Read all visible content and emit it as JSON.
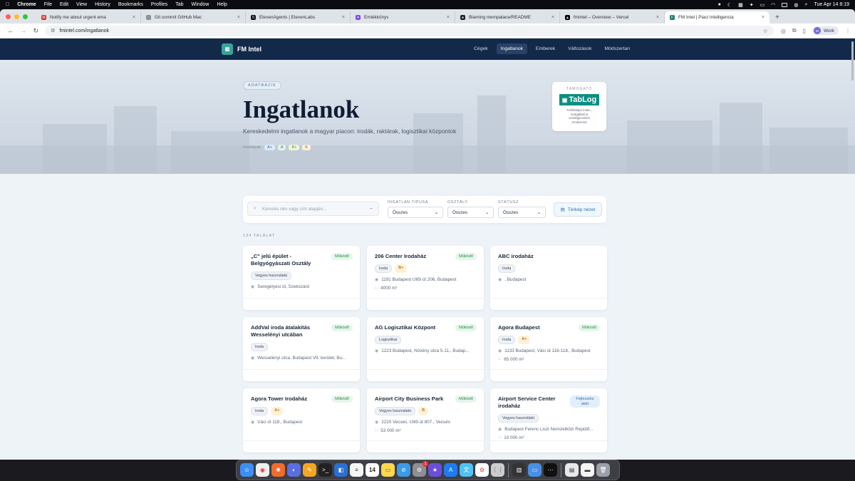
{
  "menubar": {
    "apple": "",
    "items": [
      "Chrome",
      "File",
      "Edit",
      "View",
      "History",
      "Bookmarks",
      "Profiles",
      "Tab",
      "Window",
      "Help"
    ],
    "datetime": "Tue Apr 14  8:19"
  },
  "tabs": [
    {
      "title": "Notify me about urgent ema",
      "color": "#d93025",
      "glyph": "M"
    },
    {
      "title": "Git commit GitHub Mac",
      "color": "#8a8f98",
      "glyph": "◌"
    },
    {
      "title": "ElevenAgents | ElevenLabs",
      "color": "#111111",
      "glyph": "II"
    },
    {
      "title": "Emlékkönyv",
      "color": "#7c4dff",
      "glyph": "✦"
    },
    {
      "title": "Blaming mempalace/README",
      "color": "#1f2328",
      "glyph": "●"
    },
    {
      "title": "fmintel – Overview – Vercel",
      "color": "#000000",
      "glyph": "▲"
    },
    {
      "title": "FM Intel | Piaci Intelligencia",
      "color": "#1f7a70",
      "glyph": "F"
    }
  ],
  "address": {
    "url": "fmintel.com/ingatlanok"
  },
  "profile": {
    "initials": "W",
    "label": "Work"
  },
  "site": {
    "logo_text": "FM Intel",
    "nav": [
      {
        "label": "Cégek",
        "active": false
      },
      {
        "label": "Ingatlanok",
        "active": true
      },
      {
        "label": "Emberek",
        "active": false
      },
      {
        "label": "Változások",
        "active": false
      },
      {
        "label": "Módszertan",
        "active": false
      }
    ]
  },
  "hero": {
    "badge": "ADATBÁZIS",
    "title": "Ingatlanok",
    "subtitle": "Kereskedelmi ingatlanok a magyar piacon: irodák, raktárak, logisztikai központok",
    "grades_label": "Osztályok:",
    "grades": [
      {
        "label": "A+",
        "bg": "#dde9f8",
        "fg": "#3b6fb0"
      },
      {
        "label": "A",
        "bg": "#e2f3ea",
        "fg": "#2f8a4b"
      },
      {
        "label": "B+",
        "bg": "#eef4dd",
        "fg": "#6b8a2a"
      },
      {
        "label": "B",
        "bg": "#fbeedd",
        "fg": "#b57a0e"
      }
    ]
  },
  "sponsor": {
    "label": "TÁMOGATÓ",
    "brand": "TabLog",
    "description": "Felhőalapú iroda-, szolgáltató & vendégkezelési rendszerek"
  },
  "filters": {
    "search_placeholder": "Keresés név vagy cím alapján...",
    "type_label": "INGATLAN TÍPUSA",
    "type_value": "Összes",
    "class_label": "OSZTÁLY",
    "class_value": "Összes",
    "status_label": "STÁTUSZ",
    "status_value": "Összes",
    "map_button": "Térkép nézet"
  },
  "result_count": "134 TALÁLAT",
  "cards": [
    {
      "title": "„C\" jelű épület - Belgyógyászati Osztály",
      "status": "Működő",
      "status_kind": "ok",
      "tags": [
        "Vegyes használatú"
      ],
      "grade": "",
      "address": "Seregélyesi út, Szekszárd",
      "area": ""
    },
    {
      "title": "206 Center Irodaház",
      "status": "Működő",
      "status_kind": "ok",
      "tags": [
        "Iroda"
      ],
      "grade": "B+",
      "address": "1191 Budapest Üllői út 206, Budapest",
      "area": "4000 m²"
    },
    {
      "title": "ABC irodaház",
      "status": "",
      "status_kind": "",
      "tags": [
        "Iroda"
      ],
      "grade": "",
      "address": ", Budapest",
      "area": ""
    },
    {
      "title": "AddVal iroda átalakítás Wesselényi utcában",
      "status": "Működő",
      "status_kind": "ok",
      "tags": [
        "Iroda"
      ],
      "grade": "",
      "address": "Wesselényi utca, Budapest VII. kerület, Bu...",
      "area": ""
    },
    {
      "title": "AG Logisztikai Központ",
      "status": "Működő",
      "status_kind": "ok",
      "tags": [
        "Logisztikai"
      ],
      "grade": "",
      "address": "1223 Budapest, Növény utca 5-11., Budap...",
      "area": ""
    },
    {
      "title": "Agora Budapest",
      "status": "Működő",
      "status_kind": "ok",
      "tags": [
        "Iroda"
      ],
      "grade": "A+",
      "address": "1133 Budapest, Váci út 116-118., Budapest",
      "area": "65 000 m²"
    },
    {
      "title": "Agora Tower Irodaház",
      "status": "Működő",
      "status_kind": "ok",
      "tags": [
        "Iroda"
      ],
      "grade": "A+",
      "address": "Váci út 118., Budapest",
      "area": ""
    },
    {
      "title": "Airport City Business Park",
      "status": "Működő",
      "status_kind": "ok",
      "tags": [
        "Vegyes használatú"
      ],
      "grade": "B",
      "address": "2220 Vecsés, Üllői út 807., Vecsés",
      "area": "53 000 m²"
    },
    {
      "title": "Airport Service Center irodaház",
      "status": "Fejlesztés alatt",
      "status_kind": "dev",
      "tags": [
        "Vegyes használatú"
      ],
      "grade": "",
      "address": "Budapest Ferenc Liszt Nemzetközi Repülő...",
      "area": "10 000 m²"
    }
  ],
  "dock": {
    "badges": {
      "calendar_day": "14",
      "mail_count": "1"
    }
  }
}
